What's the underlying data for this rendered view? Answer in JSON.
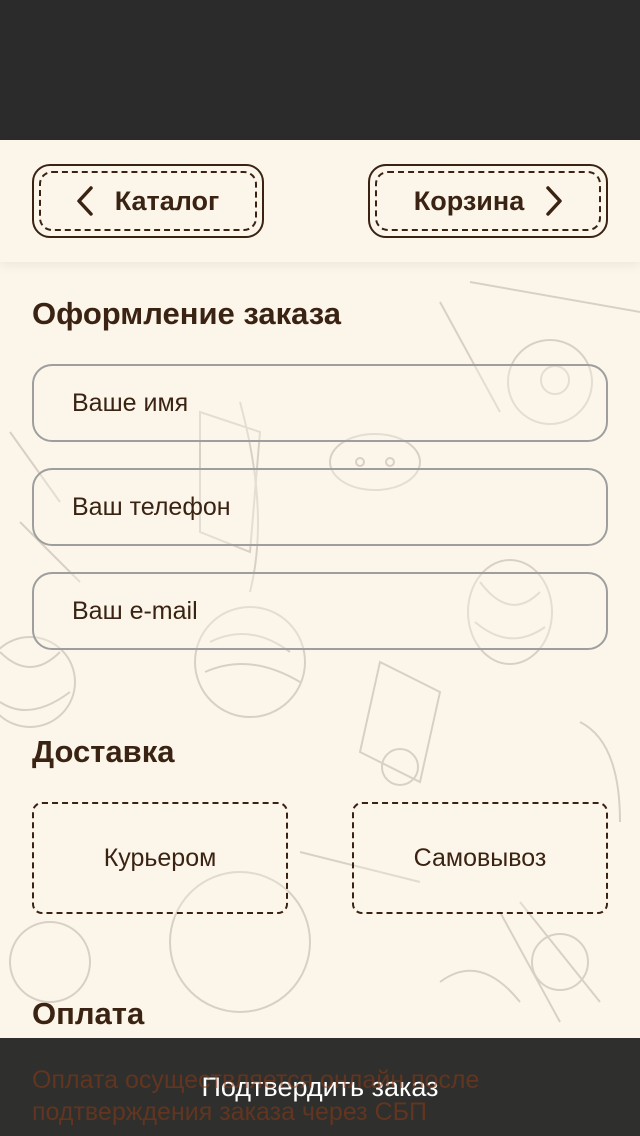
{
  "header": {
    "catalog_label": "Каталог",
    "cart_label": "Корзина",
    "catalog_icon": "chevron-left-icon",
    "cart_icon": "chevron-right-icon"
  },
  "order": {
    "title": "Оформление заказа",
    "name_placeholder": "Ваше имя",
    "phone_placeholder": "Ваш телефон",
    "email_placeholder": "Ваш e-mail"
  },
  "delivery": {
    "title": "Доставка",
    "options": [
      "Курьером",
      "Самовывоз"
    ]
  },
  "payment": {
    "title": "Оплата",
    "text": "Оплата осуществляется онлайн после подтверждения заказа через СБП"
  },
  "confirm_label": "Подтвердить заказ",
  "colors": {
    "background": "#fcf6ea",
    "text": "#3a2312",
    "status_bar": "#2b2b2b",
    "button_bar": "#222222"
  }
}
